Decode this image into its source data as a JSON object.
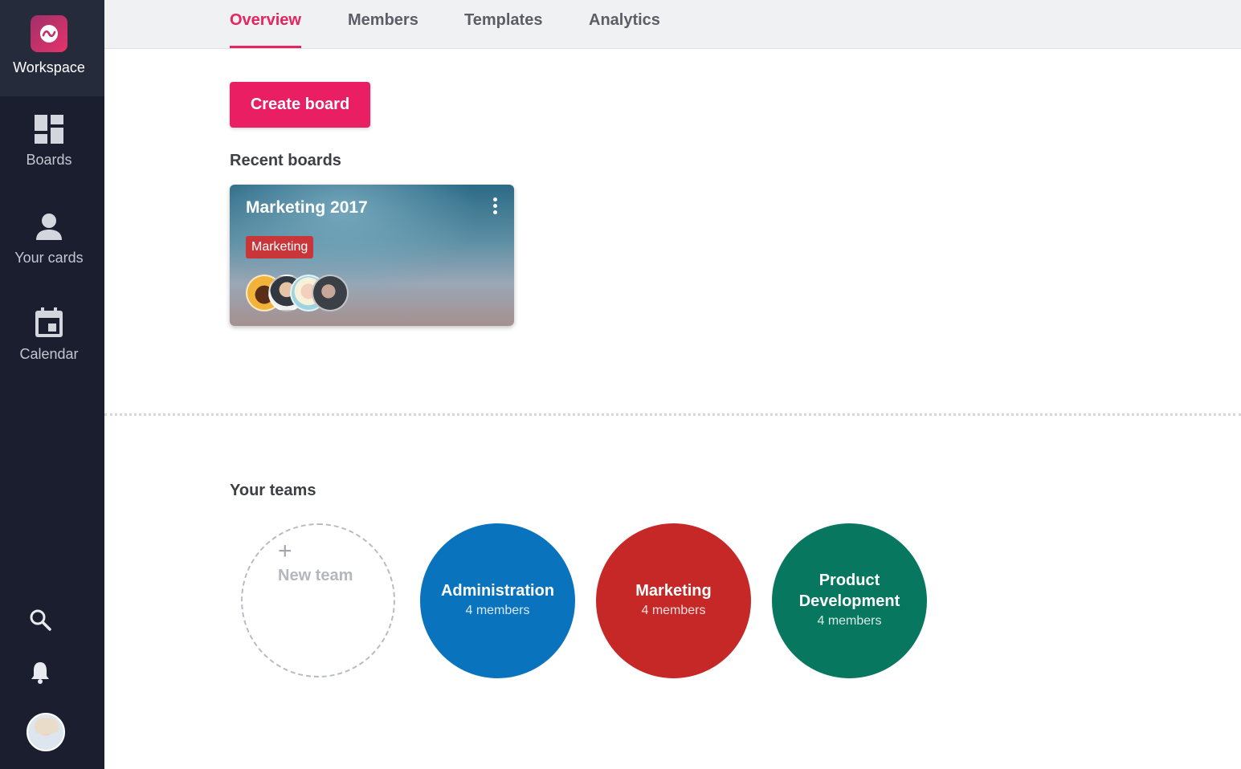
{
  "sidebar": {
    "workspace_label": "Workspace",
    "items": [
      {
        "label": "Boards",
        "icon": "boards-icon"
      },
      {
        "label": "Your cards",
        "icon": "person-icon"
      },
      {
        "label": "Calendar",
        "icon": "calendar-icon"
      }
    ],
    "bottom_icons": [
      "search-icon",
      "bell-icon",
      "user-avatar"
    ]
  },
  "tabs": [
    {
      "label": "Overview",
      "active": true
    },
    {
      "label": "Members",
      "active": false
    },
    {
      "label": "Templates",
      "active": false
    },
    {
      "label": "Analytics",
      "active": false
    }
  ],
  "main": {
    "create_label": "Create board",
    "recent_title": "Recent boards",
    "recent_boards": [
      {
        "title": "Marketing 2017",
        "tag": "Marketing",
        "member_avatars": 4
      }
    ],
    "teams_title": "Your teams",
    "new_team_label": "New team",
    "teams": [
      {
        "name": "Administration",
        "members": "4 members",
        "color": "#0a73be"
      },
      {
        "name": "Marketing",
        "members": "4 members",
        "color": "#c62828"
      },
      {
        "name": "Product Development",
        "members": "4 members",
        "color": "#08775f"
      }
    ]
  },
  "colors": {
    "accent": "#e91e63",
    "sidebar_bg": "#1a1e2e",
    "workspace_bg": "#262b3c",
    "tag_bg": "#c8363a"
  }
}
